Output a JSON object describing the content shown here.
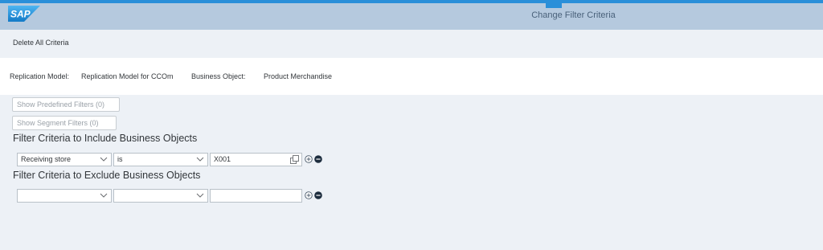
{
  "shell": {
    "logo_text": "SAP",
    "title": "Change Filter Criteria",
    "brand_color": "#2a8fd9"
  },
  "toolbar": {
    "delete_all": "Delete All Criteria"
  },
  "header": {
    "replication_model_label": "Replication Model:",
    "replication_model_value": "Replication Model for CCOm",
    "business_object_label": "Business Object:",
    "business_object_value": "Product Merchandise"
  },
  "buttons": {
    "predefined": "Show Predefined Filters (0)",
    "segment": "Show Segment Filters (0)"
  },
  "include": {
    "title": "Filter Criteria to Include Business Objects",
    "field": "Receiving store",
    "operator": "is",
    "value": "X001"
  },
  "exclude": {
    "title": "Filter Criteria to Exclude Business Objects",
    "field": "",
    "operator": "",
    "value": ""
  },
  "icons": {
    "value_help": "value-help-icon",
    "add": "add-circle-icon",
    "remove": "remove-circle-icon",
    "dropdown": "chevron-down-icon"
  }
}
